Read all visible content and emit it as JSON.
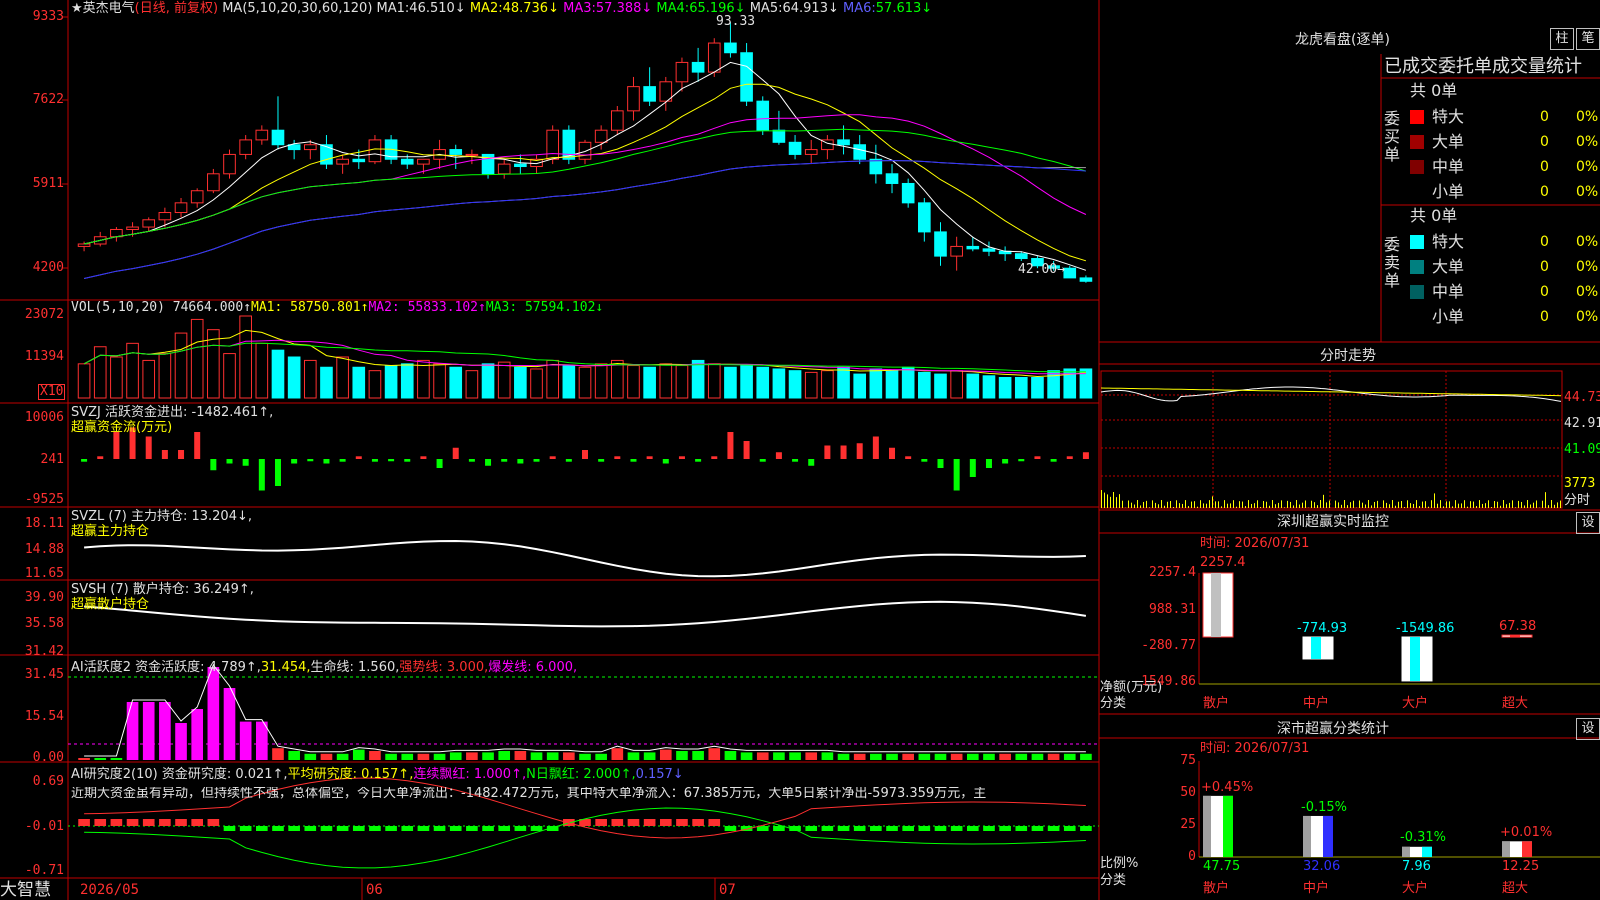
{
  "colors": {
    "up": "#ff3030",
    "down": "#00ffff",
    "bg": "#000000",
    "grid": "#c00000",
    "ma1": "#ffffff",
    "ma2": "#ffff00",
    "ma3": "#ff00ff",
    "ma4": "#00ff00",
    "ma5": "#a0a0a0",
    "ma6": "#3030ff"
  },
  "header": {
    "stock": "★英杰电气",
    "mode": "(日线, 前复权)",
    "ma_params": "MA(5,10,20,30,60,120)",
    "ma": [
      {
        "name": "MA1:",
        "value": "46.510↓"
      },
      {
        "name": "MA2:",
        "value": "48.736↓"
      },
      {
        "name": "MA3:",
        "value": "57.388↓"
      },
      {
        "name": "MA4:",
        "value": "65.196↓"
      },
      {
        "name": "MA5:",
        "value": "64.913↓"
      },
      {
        "name": "MA6:",
        "value": "57.613↓"
      }
    ]
  },
  "price_axis": [
    "9333",
    "7622",
    "5911",
    "4200"
  ],
  "price_marks": {
    "high": "93.33",
    "low": "42.00→"
  },
  "vol": {
    "label": "VOL(5,10,20)",
    "value": "74664.000↑",
    "ma1": "MA1: 58750.801↑",
    "ma2": "MA2: 55833.102↑",
    "ma3": "MA3: 57594.102↓",
    "axis": [
      "23072",
      "11394"
    ],
    "unit": "X10"
  },
  "svzj": {
    "label": "SVZJ  活跃资金进出: -1482.461↑,",
    "sub": "超赢资金流(万元)",
    "axis": [
      "10006",
      "241",
      "-9525"
    ]
  },
  "svzl": {
    "label": "SVZL (7) 主力持仓: 13.204↓,",
    "sub": "超赢主力持仓",
    "axis": [
      "18.11",
      "14.88",
      "11.65"
    ]
  },
  "svsh": {
    "label": "SVSH (7) 散户持仓: 36.249↑,",
    "sub": "超赢散户持仓",
    "axis": [
      "39.90",
      "35.58",
      "31.42"
    ]
  },
  "ai1": {
    "a": "AI活跃度2 资金活跃度: 4.789↑,",
    "b": "31.454,",
    "c": "生命线: 1.560,",
    "d": "强势线: 3.000,",
    "e": "爆发线: 6.000,",
    "axis": [
      "31.45",
      "15.54",
      "0.00"
    ]
  },
  "ai2": {
    "a": "AI研究度2(10) 资金研究度: 0.021↑,",
    "b": "平均研究度: 0.157↑,",
    "c": "连续飘红: 1.000↑,",
    "d": "N日飘红: 2.000↑,",
    "e": "0.157↓",
    "axis": [
      "0.69",
      "-0.01",
      "-0.71"
    ]
  },
  "commentary": "近期大资金虽有异动，但持续性不强，总体偏空，今日大单净流出：-1482.472万元，其中特大单净流入：67.385万元，大单5日累计净出-5973.359万元，主",
  "date_axis": [
    "2026/05",
    "06",
    "07"
  ],
  "footer": {
    "brand": "大智慧"
  },
  "right": {
    "lhb": {
      "title": "龙虎看盘(逐单)",
      "btn1": "柱",
      "btn2": "笔",
      "subtitle": "已成交委托单成交量统计",
      "buy": {
        "side": "委买单",
        "total": "共 0单",
        "rows": [
          {
            "name": "特大",
            "v": "0",
            "p": "0%"
          },
          {
            "name": "大单",
            "v": "0",
            "p": "0%"
          },
          {
            "name": "中单",
            "v": "0",
            "p": "0%"
          },
          {
            "name": "小单",
            "v": "0",
            "p": "0%"
          }
        ]
      },
      "sell": {
        "side": "委卖单",
        "total": "共 0单",
        "rows": [
          {
            "name": "特大",
            "v": "0",
            "p": "0%"
          },
          {
            "name": "大单",
            "v": "0",
            "p": "0%"
          },
          {
            "name": "中单",
            "v": "0",
            "p": "0%"
          },
          {
            "name": "小单",
            "v": "0",
            "p": "0%"
          }
        ]
      }
    },
    "fs": {
      "title": "分时走势",
      "axis": [
        "44.73",
        "42.91",
        "41.09",
        "3773",
        "分时"
      ]
    },
    "mon": {
      "title": "深圳超赢实时监控",
      "btn": "设",
      "time": "时间: 2026/07/31",
      "axis": [
        "2257.4",
        "988.31",
        "-280.77",
        "-1549.86"
      ],
      "ylabel": "净额(万元)",
      "xlabel": "分类",
      "cats": [
        "散户",
        "中户",
        "大户",
        "超大"
      ],
      "values": [
        2257.4,
        -774.93,
        -1549.86,
        67.38
      ],
      "labels": [
        "2257.4",
        "-774.93",
        "-1549.86",
        "67.38"
      ]
    },
    "cls": {
      "title": "深市超赢分类统计",
      "btn": "设",
      "time": "时间: 2026/07/31",
      "axis": [
        "75",
        "50",
        "25",
        "0"
      ],
      "ylabel": "比例%",
      "xlabel": "分类",
      "cats": [
        "散户",
        "中户",
        "大户",
        "超大"
      ],
      "values": [
        47.75,
        32.06,
        7.96,
        12.25
      ],
      "labels": [
        "47.75",
        "32.06",
        "7.96",
        "12.25"
      ],
      "changes": [
        "+0.45%",
        "-0.15%",
        "-0.31%",
        "+0.01%"
      ]
    }
  },
  "chart_data": {
    "type": "candlestick",
    "candles": [
      [
        47,
        48,
        46,
        47.5
      ],
      [
        47.5,
        50,
        47,
        49
      ],
      [
        49,
        51,
        48,
        50.5
      ],
      [
        50.5,
        52,
        49,
        51
      ],
      [
        51,
        53,
        50,
        52.5
      ],
      [
        52.5,
        55,
        51,
        54
      ],
      [
        54,
        57,
        53,
        56
      ],
      [
        56,
        59,
        55,
        58.5
      ],
      [
        58.5,
        63,
        58,
        62
      ],
      [
        62,
        67,
        61,
        66
      ],
      [
        66,
        70,
        65,
        69
      ],
      [
        69,
        72,
        68,
        71
      ],
      [
        71,
        78,
        67,
        68
      ],
      [
        68,
        69,
        65,
        67
      ],
      [
        67,
        69,
        65,
        68
      ],
      [
        68,
        70,
        63,
        64
      ],
      [
        64,
        66,
        62,
        65
      ],
      [
        65,
        67,
        63,
        64.5
      ],
      [
        64.5,
        70,
        64,
        69
      ],
      [
        69,
        70,
        64,
        65
      ],
      [
        65,
        66,
        63,
        64
      ],
      [
        64,
        65,
        62,
        65
      ],
      [
        65,
        69,
        63,
        67
      ],
      [
        67,
        68,
        63,
        66
      ],
      [
        66,
        67,
        64,
        66
      ],
      [
        66,
        63,
        61,
        62
      ],
      [
        62,
        65,
        61,
        64
      ],
      [
        64,
        66,
        62,
        63.5
      ],
      [
        63.5,
        66,
        62,
        65
      ],
      [
        65,
        72,
        64,
        71
      ],
      [
        71,
        72,
        64,
        65
      ],
      [
        65,
        69,
        64,
        68.5
      ],
      [
        68.5,
        72,
        67,
        71
      ],
      [
        71,
        76,
        70,
        75
      ],
      [
        75,
        82,
        73,
        80
      ],
      [
        80,
        84,
        76,
        77
      ],
      [
        77,
        82,
        75,
        81
      ],
      [
        81,
        86,
        79,
        85
      ],
      [
        85,
        88,
        81,
        83
      ],
      [
        83,
        90,
        82,
        89
      ],
      [
        89,
        93.33,
        86,
        87
      ],
      [
        87,
        89,
        76,
        77
      ],
      [
        77,
        78,
        70,
        71
      ],
      [
        71,
        75,
        68,
        68.5
      ],
      [
        68.5,
        70,
        65,
        66
      ],
      [
        66,
        69,
        64,
        67
      ],
      [
        67,
        70,
        65,
        69
      ],
      [
        69,
        72,
        66,
        68
      ],
      [
        68,
        70,
        64,
        65
      ],
      [
        65,
        68,
        60,
        62
      ],
      [
        62,
        64,
        58,
        60
      ],
      [
        60,
        61,
        55,
        56
      ],
      [
        56,
        57,
        48,
        50
      ],
      [
        50,
        52,
        43,
        45
      ],
      [
        45,
        49,
        42,
        47
      ],
      [
        47,
        49,
        46,
        46.5
      ],
      [
        46.5,
        48,
        45,
        46
      ],
      [
        46,
        47,
        44,
        45.5
      ],
      [
        45.5,
        46,
        44,
        44.5
      ],
      [
        44.5,
        45,
        42.5,
        43
      ],
      [
        43,
        44,
        42,
        42.5
      ],
      [
        42.5,
        43,
        41,
        40.5
      ],
      [
        40.5,
        41,
        39.5,
        39.8
      ]
    ],
    "price_range": [
      38,
      95
    ],
    "volume": [
      100,
      150,
      120,
      160,
      110,
      130,
      190,
      230,
      200,
      130,
      240,
      160,
      140,
      120,
      110,
      90,
      120,
      90,
      80,
      95,
      100,
      110,
      100,
      90,
      80,
      100,
      105,
      90,
      85,
      110,
      95,
      90,
      100,
      110,
      95,
      90,
      100,
      95,
      110,
      100,
      90,
      95,
      90,
      85,
      80,
      75,
      80,
      90,
      70,
      85,
      80,
      90,
      75,
      70,
      80,
      70,
      65,
      60,
      60,
      60,
      80,
      85,
      85
    ],
    "vol_range": [
      0,
      240
    ]
  }
}
